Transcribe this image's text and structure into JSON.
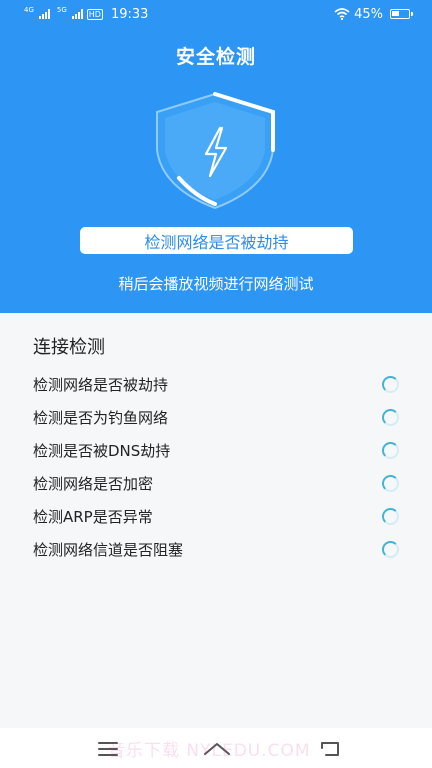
{
  "status_bar": {
    "signal_1_label": "4G",
    "signal_2_label": "5G",
    "hd_label": "HD",
    "time": "19:33",
    "battery": "45%",
    "battery_level": 0.45
  },
  "header": {
    "title": "安全检测"
  },
  "current_check": "检测网络是否被劫持",
  "hint": "稍后会播放视频进行网络测试",
  "section": {
    "title": "连接检测",
    "items": [
      {
        "label": "检测网络是否被劫持",
        "status": "loading"
      },
      {
        "label": "检测是否为钓鱼网络",
        "status": "loading"
      },
      {
        "label": "检测是否被DNS劫持",
        "status": "loading"
      },
      {
        "label": "检测网络是否加密",
        "status": "loading"
      },
      {
        "label": "检测ARP是否异常",
        "status": "loading"
      },
      {
        "label": "检测网络信道是否阻塞",
        "status": "loading"
      }
    ]
  },
  "watermark": "音乐下载  NYLEDU.COM",
  "colors": {
    "primary": "#2d95f3",
    "spinner": "#43b4d2"
  }
}
